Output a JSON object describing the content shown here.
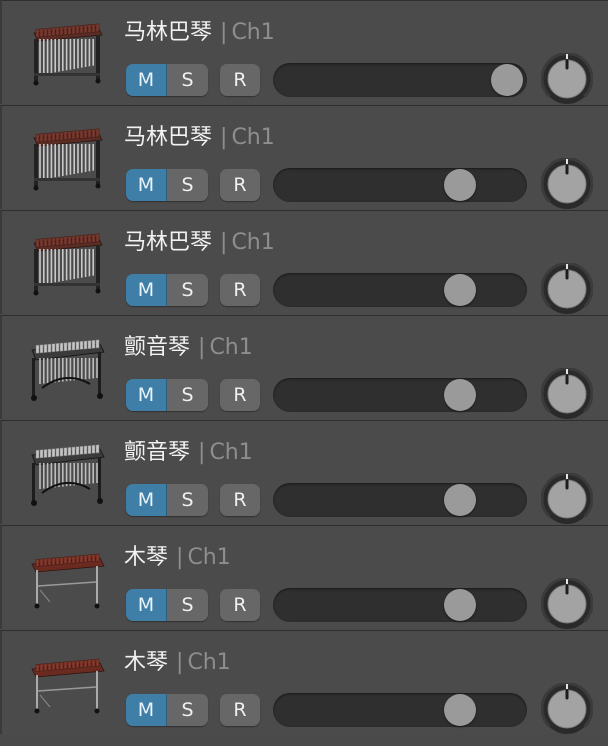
{
  "tracks": [
    {
      "name": "马林巴琴",
      "separator": "|",
      "channel": "Ch1",
      "mute": "M",
      "solo": "S",
      "record": "R",
      "volume_fraction": 1.0,
      "instrument_icon": "marimba-icon"
    },
    {
      "name": "马林巴琴",
      "separator": "|",
      "channel": "Ch1",
      "mute": "M",
      "solo": "S",
      "record": "R",
      "volume_fraction": 0.78,
      "instrument_icon": "marimba-icon"
    },
    {
      "name": "马林巴琴",
      "separator": "|",
      "channel": "Ch1",
      "mute": "M",
      "solo": "S",
      "record": "R",
      "volume_fraction": 0.78,
      "instrument_icon": "marimba-icon"
    },
    {
      "name": "颤音琴",
      "separator": "|",
      "channel": "Ch1",
      "mute": "M",
      "solo": "S",
      "record": "R",
      "volume_fraction": 0.78,
      "instrument_icon": "vibraphone-icon"
    },
    {
      "name": "颤音琴",
      "separator": "|",
      "channel": "Ch1",
      "mute": "M",
      "solo": "S",
      "record": "R",
      "volume_fraction": 0.78,
      "instrument_icon": "vibraphone-icon"
    },
    {
      "name": "木琴",
      "separator": "|",
      "channel": "Ch1",
      "mute": "M",
      "solo": "S",
      "record": "R",
      "volume_fraction": 0.78,
      "instrument_icon": "xylophone-icon"
    },
    {
      "name": "木琴",
      "separator": "|",
      "channel": "Ch1",
      "mute": "M",
      "solo": "S",
      "record": "R",
      "volume_fraction": 0.78,
      "instrument_icon": "xylophone-icon"
    }
  ],
  "colors": {
    "mute_active": "#3f7ea7",
    "button": "#676767",
    "slider_track": "#2f2f2f",
    "thumb": "#9a9a9a"
  }
}
